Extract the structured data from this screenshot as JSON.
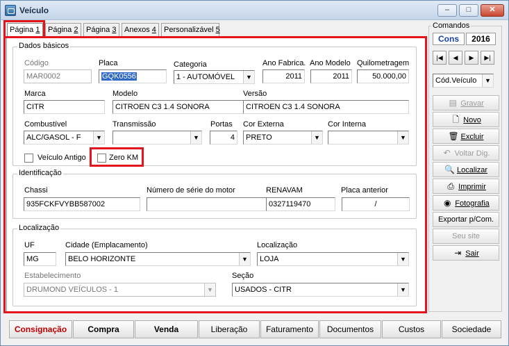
{
  "window": {
    "title": "Veículo"
  },
  "tabs": [
    {
      "label": "Página ",
      "key": "1"
    },
    {
      "label": "Página ",
      "key": "2"
    },
    {
      "label": "Página ",
      "key": "3"
    },
    {
      "label": "Anexos ",
      "key": "4"
    },
    {
      "label": "Personalizável ",
      "key": "5"
    }
  ],
  "dados_basicos": {
    "legend": "Dados básicos",
    "codigo": {
      "label": "Código",
      "value": "MAR0002"
    },
    "placa": {
      "label": "Placa",
      "value": "GQK0556"
    },
    "categoria": {
      "label": "Categoria",
      "value": "1 - AUTOMÓVEL"
    },
    "ano_fabrica": {
      "label": "Ano Fabrica.",
      "value": "2011"
    },
    "ano_modelo": {
      "label": "Ano Modelo",
      "value": "2011"
    },
    "quilometragem": {
      "label": "Quilometragem",
      "value": "50.000,00"
    },
    "marca": {
      "label": "Marca",
      "value": "CITR"
    },
    "modelo": {
      "label": "Modelo",
      "value": "CITROEN C3 1.4 SONORA"
    },
    "versao": {
      "label": "Versão",
      "value": "CITROEN C3 1.4 SONORA"
    },
    "combustivel": {
      "label": "Combustível",
      "value": "ALC/GASOL - F"
    },
    "transmissao": {
      "label": "Transmissão",
      "value": ""
    },
    "portas": {
      "label": "Portas",
      "value": "4"
    },
    "cor_externa": {
      "label": "Cor Externa",
      "value": "PRETO"
    },
    "cor_interna": {
      "label": "Cor Interna",
      "value": ""
    },
    "veiculo_antigo": {
      "label": "Veículo Antigo"
    },
    "zero_km": {
      "label": "Zero KM"
    }
  },
  "identificacao": {
    "legend": "Identificação",
    "chassi": {
      "label": "Chassi",
      "value": "935FCKFVYBB587002"
    },
    "serie_motor": {
      "label": "Número de série do motor",
      "value": ""
    },
    "renavam": {
      "label": "RENAVAM",
      "value": "0327119470"
    },
    "placa_anterior": {
      "label": "Placa anterior",
      "value": "/"
    }
  },
  "localizacao": {
    "legend": "Localização",
    "uf": {
      "label": "UF",
      "value": "MG"
    },
    "cidade": {
      "label": "Cidade (Emplacamento)",
      "value": "BELO HORIZONTE"
    },
    "localizacao": {
      "label": "Localização",
      "value": "LOJA"
    },
    "estabelecimento": {
      "label": "Estabelecimento",
      "value": "DRUMOND VEÍCULOS - 1"
    },
    "secao": {
      "label": "Seção",
      "value": "USADOS - CITR"
    }
  },
  "comandos": {
    "legend": "Comandos",
    "mode": "Cons",
    "year": "2016",
    "sort": "Cód.Veículo",
    "nav": {
      "first": "|◀",
      "prev": "◀",
      "next": "▶",
      "last": "▶|"
    },
    "buttons": {
      "gravar": "Gravar",
      "novo": "Novo",
      "excluir": "Excluir",
      "voltar": "Voltar Dig.",
      "localizar": "Localizar",
      "imprimir": "Imprimir",
      "fotografia": "Fotografia",
      "exportar": "Exportar p/Com.",
      "seu_site": "Seu site",
      "sair": "Sair"
    }
  },
  "bottom": [
    "Consignação",
    "Compra",
    "Venda",
    "Liberação",
    "Faturamento",
    "Documentos",
    "Custos",
    "Sociedade"
  ]
}
